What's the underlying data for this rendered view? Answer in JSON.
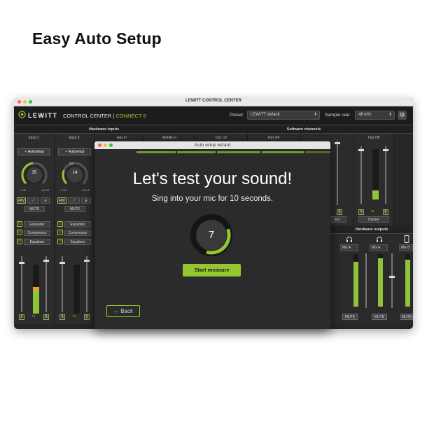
{
  "marketing": {
    "headline": "Easy Auto Setup"
  },
  "window": {
    "title": "LEWITT CONTROL CENTER",
    "traffic_colors": [
      "#ff5f57",
      "#febc2e",
      "#28c840"
    ]
  },
  "app_header": {
    "logo": "LEWITT",
    "product_name": "CONTROL CENTER |",
    "product_model": "CONNECT 6",
    "preset_label": "Preset:",
    "preset_value": "LEWITT default",
    "sample_rate_label": "Sample rate:",
    "sample_rate_value": "48 kHz",
    "settings_icon": "gear-icon"
  },
  "sections": {
    "hardware_inputs": "Hardware inputs",
    "software_channels": "Software channels",
    "hardware_outputs": "Hardware outputs"
  },
  "inputs": [
    {
      "title": "Input 1",
      "autosetup": "Autosetup",
      "knob_value": "35",
      "knob_min": "-4 dB",
      "knob_max": "+48 dB",
      "phantom": "48V",
      "mute": "MUTE",
      "expander": "Expander",
      "compressor": "Compressor",
      "equalizer": "Equalizer"
    },
    {
      "title": "Input 2",
      "autosetup": "Autosetup",
      "knob_value": "14",
      "knob_min": "-4 dB",
      "knob_max": "+48 dB",
      "phantom": "48V",
      "mute": "MUTE",
      "expander": "Expander",
      "compressor": "Compressor",
      "equalizer": "Equalizer"
    }
  ],
  "hidden_strip_titles": [
    "Aux in",
    "Mobile in",
    "Out 1/2",
    "Out 3/4"
  ],
  "out78": {
    "title": "Out 7/8",
    "ducker": "Ducker"
  },
  "partial_ducker": "ker",
  "meter_scale": [
    "0",
    "-3",
    "-6",
    "-12",
    "-18",
    "-24",
    "-30",
    "-36",
    "-42",
    "-48",
    "-54",
    "-60"
  ],
  "meter_levels": {
    "input1": 0.55,
    "input2": 0.0,
    "out78": 0.18
  },
  "ab_labels": {
    "a": "A",
    "b": "B"
  },
  "outputs": [
    {
      "mix": "Mix A",
      "mute": "MUTE",
      "icon": "headphones-icon",
      "level": 0.85
    },
    {
      "mix": "Mix A",
      "mute": "MUTE",
      "icon": "headphones-icon",
      "level": 0.92
    },
    {
      "mix": "Mix B",
      "mute": "MUTE",
      "icon": "phone-icon",
      "level": 0.9
    }
  ],
  "wizard": {
    "title": "Auto setup wizard",
    "heading": "Let's test your sound!",
    "subheading": "Sing into your mic for 10 seconds.",
    "countdown": "7",
    "start_button": "Start measure",
    "back_button": "← Back",
    "accent": "#95c631"
  }
}
